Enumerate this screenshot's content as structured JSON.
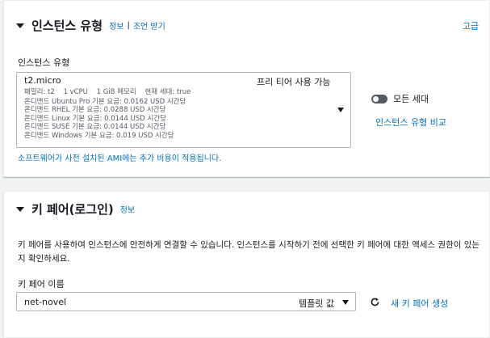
{
  "instance_section": {
    "title": "인스턴스 유형",
    "info_link": "정보",
    "separator": "|",
    "advice_link": "조언 받기",
    "advanced_link": "고급",
    "field_label": "인스턴스 유형",
    "selected": {
      "name": "t2.micro",
      "badge": "프리 티어 사용 가능",
      "family": "패밀리: t2",
      "vcpu": "1 vCPU",
      "memory": "1 GiB 메모리",
      "generation": "현재 세대: true",
      "prices": [
        "온디맨드 Ubuntu Pro 기본 요금: 0.0162 USD 시간당",
        "온디맨드 RHEL 기본 요금: 0.0288 USD 시간당",
        "온디맨드 Linux 기본 요금: 0.0144 USD 시간당",
        "온디맨드 SUSE 기본 요금: 0.0144 USD 시간당",
        "온디맨드 Windows 기본 요금: 0.019 USD 시간당"
      ]
    },
    "all_generations_toggle": {
      "label": "모든 세대",
      "checked": false
    },
    "compare_link": "인스턴스 유형 비교",
    "ami_note": "소프트웨어가 사전 설치된 AMI에는 추가 비용이 적용됩니다."
  },
  "keypair_section": {
    "title": "키 페어(로그인)",
    "info_link": "정보",
    "description": "키 페어를 사용하여 인스턴스에 안전하게 연결할 수 있습니다. 인스턴스를 시작하기 전에 선택한 키 페어에 대한 액세스 권한이 있는지 확인하세요.",
    "field_label": "키 페어 이름",
    "selected_value": "net-novel",
    "value_tag": "템플릿 값",
    "new_keypair_link": "새 키 페어 생성",
    "refresh_icon": "refresh-icon"
  },
  "colors": {
    "link": "#0073bb",
    "text": "#16191f",
    "secondary_text": "#545b64",
    "border": "#aab7b8",
    "background": "#f2f3f3"
  }
}
